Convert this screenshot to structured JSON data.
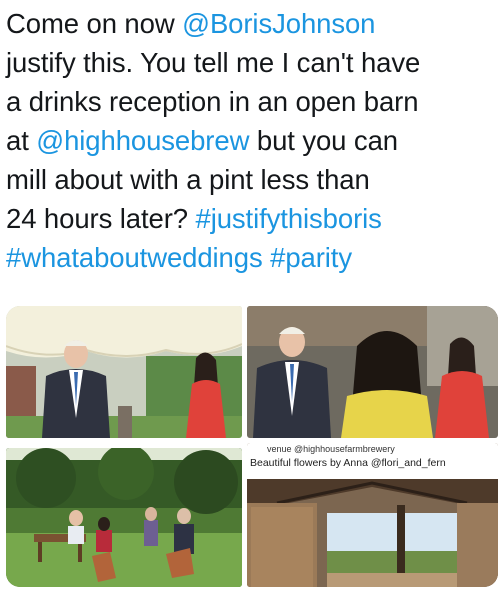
{
  "tweet": {
    "lines": [
      [
        {
          "t": "Come on now "
        },
        {
          "t": "@BorisJohnson",
          "link": true
        }
      ],
      [
        {
          "t": "justify this. You tell me I can't have"
        }
      ],
      [
        {
          "t": "a drinks reception in an open barn"
        }
      ],
      [
        {
          "t": "at "
        },
        {
          "t": "@highhousebrew",
          "link": true
        },
        {
          "t": " but you can"
        }
      ],
      [
        {
          "t": "mill about with a pint less than"
        }
      ],
      [
        {
          "t": "24 hours later? "
        },
        {
          "t": "#justifythisboris",
          "link": true
        }
      ],
      [
        {
          "t": "#whataboutweddings",
          "link": true
        },
        {
          "t": " "
        },
        {
          "t": "#parity",
          "link": true
        }
      ]
    ]
  },
  "media": {
    "caption_top": "venue @highhousefarmbrewery",
    "caption_bottom": "Beautiful flowers by Anna @flori_and_fern"
  },
  "colors": {
    "link": "#1b95e0",
    "text": "#14171a"
  }
}
